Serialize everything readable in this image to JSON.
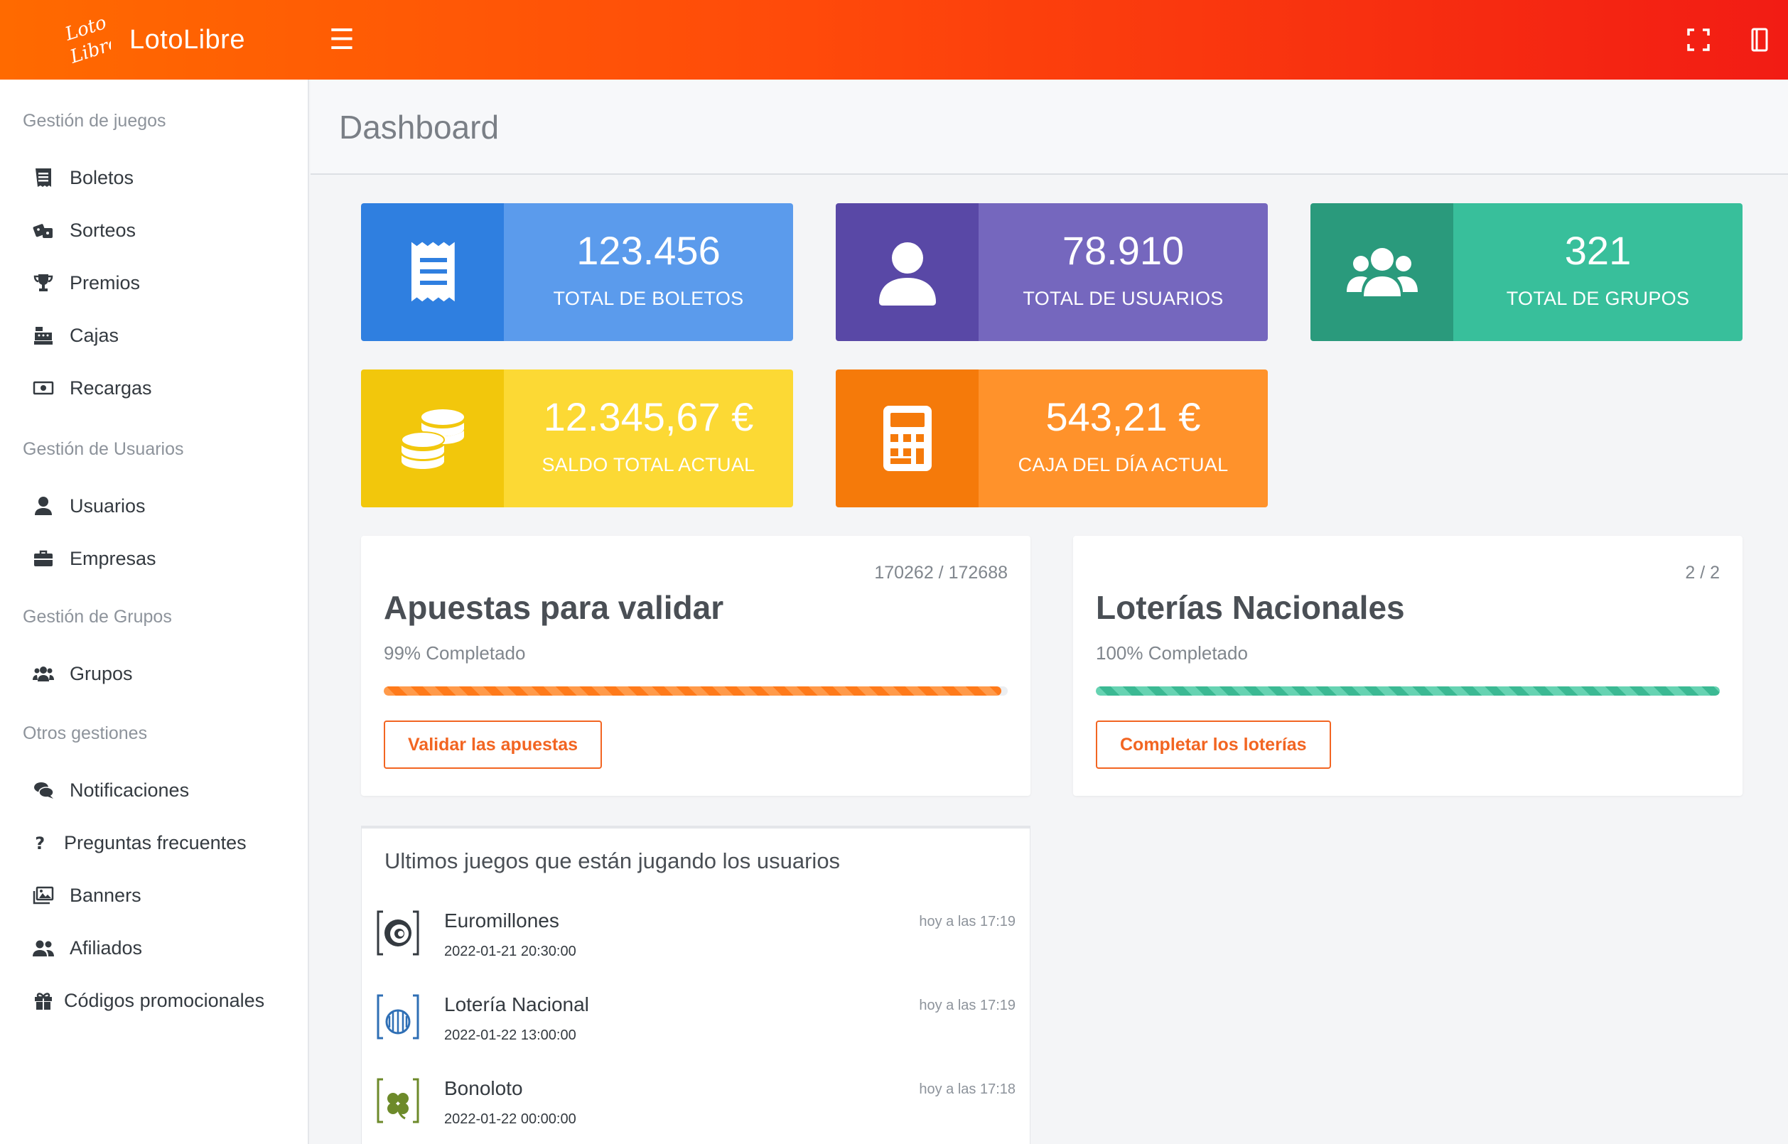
{
  "header": {
    "brand_name": "LotoLibre",
    "logo_text": "Loto Libre",
    "menu_icon": "hamburger-icon",
    "fullscreen_icon": "expand-icon",
    "panel_icon": "panel-icon",
    "gradient_start": "#ff6a00",
    "gradient_end": "#f21c14"
  },
  "sidebar": {
    "sections": [
      {
        "title": "Gestión de juegos"
      },
      {
        "title": "Gestión de Usuarios"
      },
      {
        "title": "Gestión de Grupos"
      },
      {
        "title": "Otros gestiones"
      }
    ],
    "items": [
      {
        "label": "Boletos",
        "icon": "receipt-icon"
      },
      {
        "label": "Sorteos",
        "icon": "dice-icon"
      },
      {
        "label": "Premios",
        "icon": "trophy-icon"
      },
      {
        "label": "Cajas",
        "icon": "cash-register-icon"
      },
      {
        "label": "Recargas",
        "icon": "money-bill-icon"
      },
      {
        "label": "Usuarios",
        "icon": "user-icon"
      },
      {
        "label": "Empresas",
        "icon": "briefcase-icon"
      },
      {
        "label": "Grupos",
        "icon": "users-icon"
      },
      {
        "label": "Notificaciones",
        "icon": "comments-icon"
      },
      {
        "label": "Preguntas frecuentes",
        "icon": "question-icon"
      },
      {
        "label": "Banners",
        "icon": "images-icon"
      },
      {
        "label": "Afiliados",
        "icon": "user-friends-icon"
      },
      {
        "label": "Códigos promocionales",
        "icon": "gift-icon"
      }
    ]
  },
  "page": {
    "title": "Dashboard"
  },
  "stats": [
    {
      "value": "123.456",
      "label": "TOTAL DE BOLETOS",
      "icon": "receipt-icon",
      "color_dark": "#2f7fe0",
      "color_light": "#5b9bec"
    },
    {
      "value": "78.910",
      "label": "TOTAL DE USUARIOS",
      "icon": "user-icon",
      "color_dark": "#5948a6",
      "color_light": "#7567be"
    },
    {
      "value": "321",
      "label": "TOTAL DE GRUPOS",
      "icon": "users-icon",
      "color_dark": "#2a9a7c",
      "color_light": "#38bf9b"
    },
    {
      "value": "12.345,67 €",
      "label": "SALDO TOTAL ACTUAL",
      "icon": "coins-icon",
      "color_dark": "#f2c70c",
      "color_light": "#fcd934"
    },
    {
      "value": "543,21 €",
      "label": "CAJA DEL DÍA ACTUAL",
      "icon": "calculator-icon",
      "color_dark": "#f57a0a",
      "color_light": "#ff922b"
    }
  ],
  "cards": [
    {
      "count": "170262 / 172688",
      "title": "Apuestas para validar",
      "subtitle": "99% Completado",
      "progress": 99,
      "button": "Validar las apuestas"
    },
    {
      "count": "2 / 2",
      "title": "Loterías Nacionales",
      "subtitle": "100% Completado",
      "progress": 100,
      "button": "Completar los loterías"
    }
  ],
  "games": {
    "title": "Ultimos juegos que están jugando los usuarios",
    "rows": [
      {
        "name": "Euromillones",
        "date": "2022-01-21 20:30:00",
        "time": "hoy a las 17:19",
        "icon": "euromillones-logo-icon"
      },
      {
        "name": "Lotería Nacional",
        "date": "2022-01-22 13:00:00",
        "time": "hoy a las 17:19",
        "icon": "loteria-nacional-logo-icon"
      },
      {
        "name": "Bonoloto",
        "date": "2022-01-22 00:00:00",
        "time": "hoy a las 17:18",
        "icon": "bonoloto-logo-icon"
      }
    ]
  }
}
